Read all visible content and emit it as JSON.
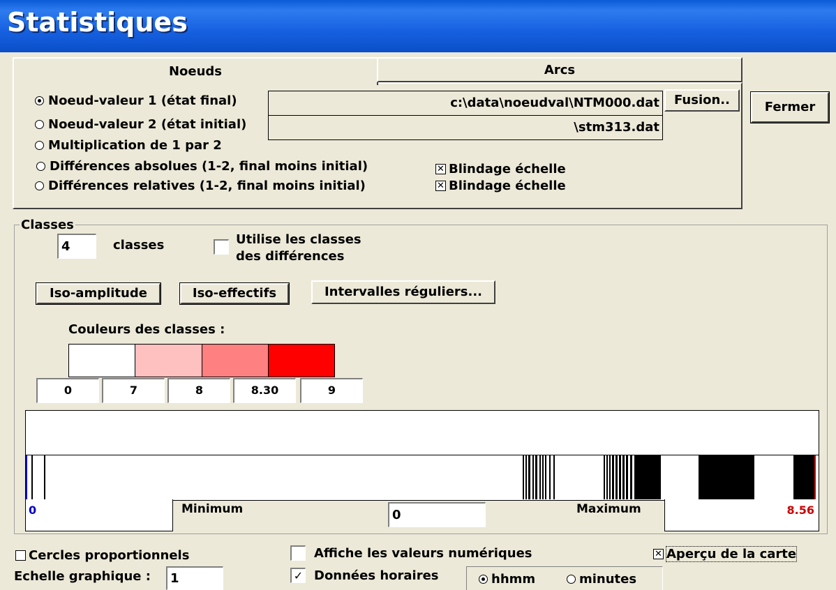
{
  "window": {
    "title": "Statistiques"
  },
  "tabs": [
    {
      "label": "Noeuds",
      "active": true
    },
    {
      "label": "Arcs",
      "active": false
    }
  ],
  "noeuds": {
    "options": [
      {
        "label": "Noeud-valeur 1 (état final)",
        "checked": true
      },
      {
        "label": "Noeud-valeur 2 (état initial)",
        "checked": false
      },
      {
        "label": "Multiplication de 1 par 2",
        "checked": false
      },
      {
        "label": "Différences absolues (1-2, final moins initial)",
        "checked": false
      },
      {
        "label": "Différences relatives (1-2, final moins initial)",
        "checked": false
      }
    ],
    "file1": "c:\\data\\noeudval\\NTM000.dat",
    "file2": "\\stm313.dat",
    "fusion_label": "Fusion..",
    "blindage": [
      {
        "label": "Blindage échelle",
        "checked": true
      },
      {
        "label": "Blindage échelle",
        "checked": true
      }
    ]
  },
  "fermer_label": "Fermer",
  "classes": {
    "group_label": "Classes",
    "count": "4",
    "count_label": "classes",
    "utilise_line1": "Utilise les classes",
    "utilise_line2": "des différences",
    "utilise_checked": false,
    "btn_iso_amplitude": "Iso-amplitude",
    "btn_iso_effectifs": "Iso-effectifs",
    "btn_intervalles": "Intervalles réguliers...",
    "couleurs_label": "Couleurs des classes :",
    "colors": [
      "#FFFFFF",
      "#FFC0C0",
      "#FF8080",
      "#FF0000"
    ],
    "bounds": [
      "0",
      "7",
      "8",
      "8.30",
      "9"
    ],
    "minimum_value": "0",
    "minimum_label": "Minimum",
    "middle_value": "0",
    "maximum_label": "Maximum",
    "maximum_value": "8.56",
    "minimum_color": "#0000CC",
    "maximum_color": "#CC0000"
  },
  "bottom": {
    "cercles_label": "Cercles proportionnels",
    "cercles_checked": false,
    "echelle_label": "Echelle graphique :",
    "echelle_value": "1",
    "affiche_label": "Affiche les valeurs numériques",
    "affiche_checked": false,
    "donnees_label": "Données horaires",
    "donnees_checked": true,
    "hhmm_label": "hhmm",
    "minutes_label": "minutes",
    "hhmm_selected": true,
    "apercu_label": "Aperçu de la carte",
    "apercu_checked": true
  }
}
